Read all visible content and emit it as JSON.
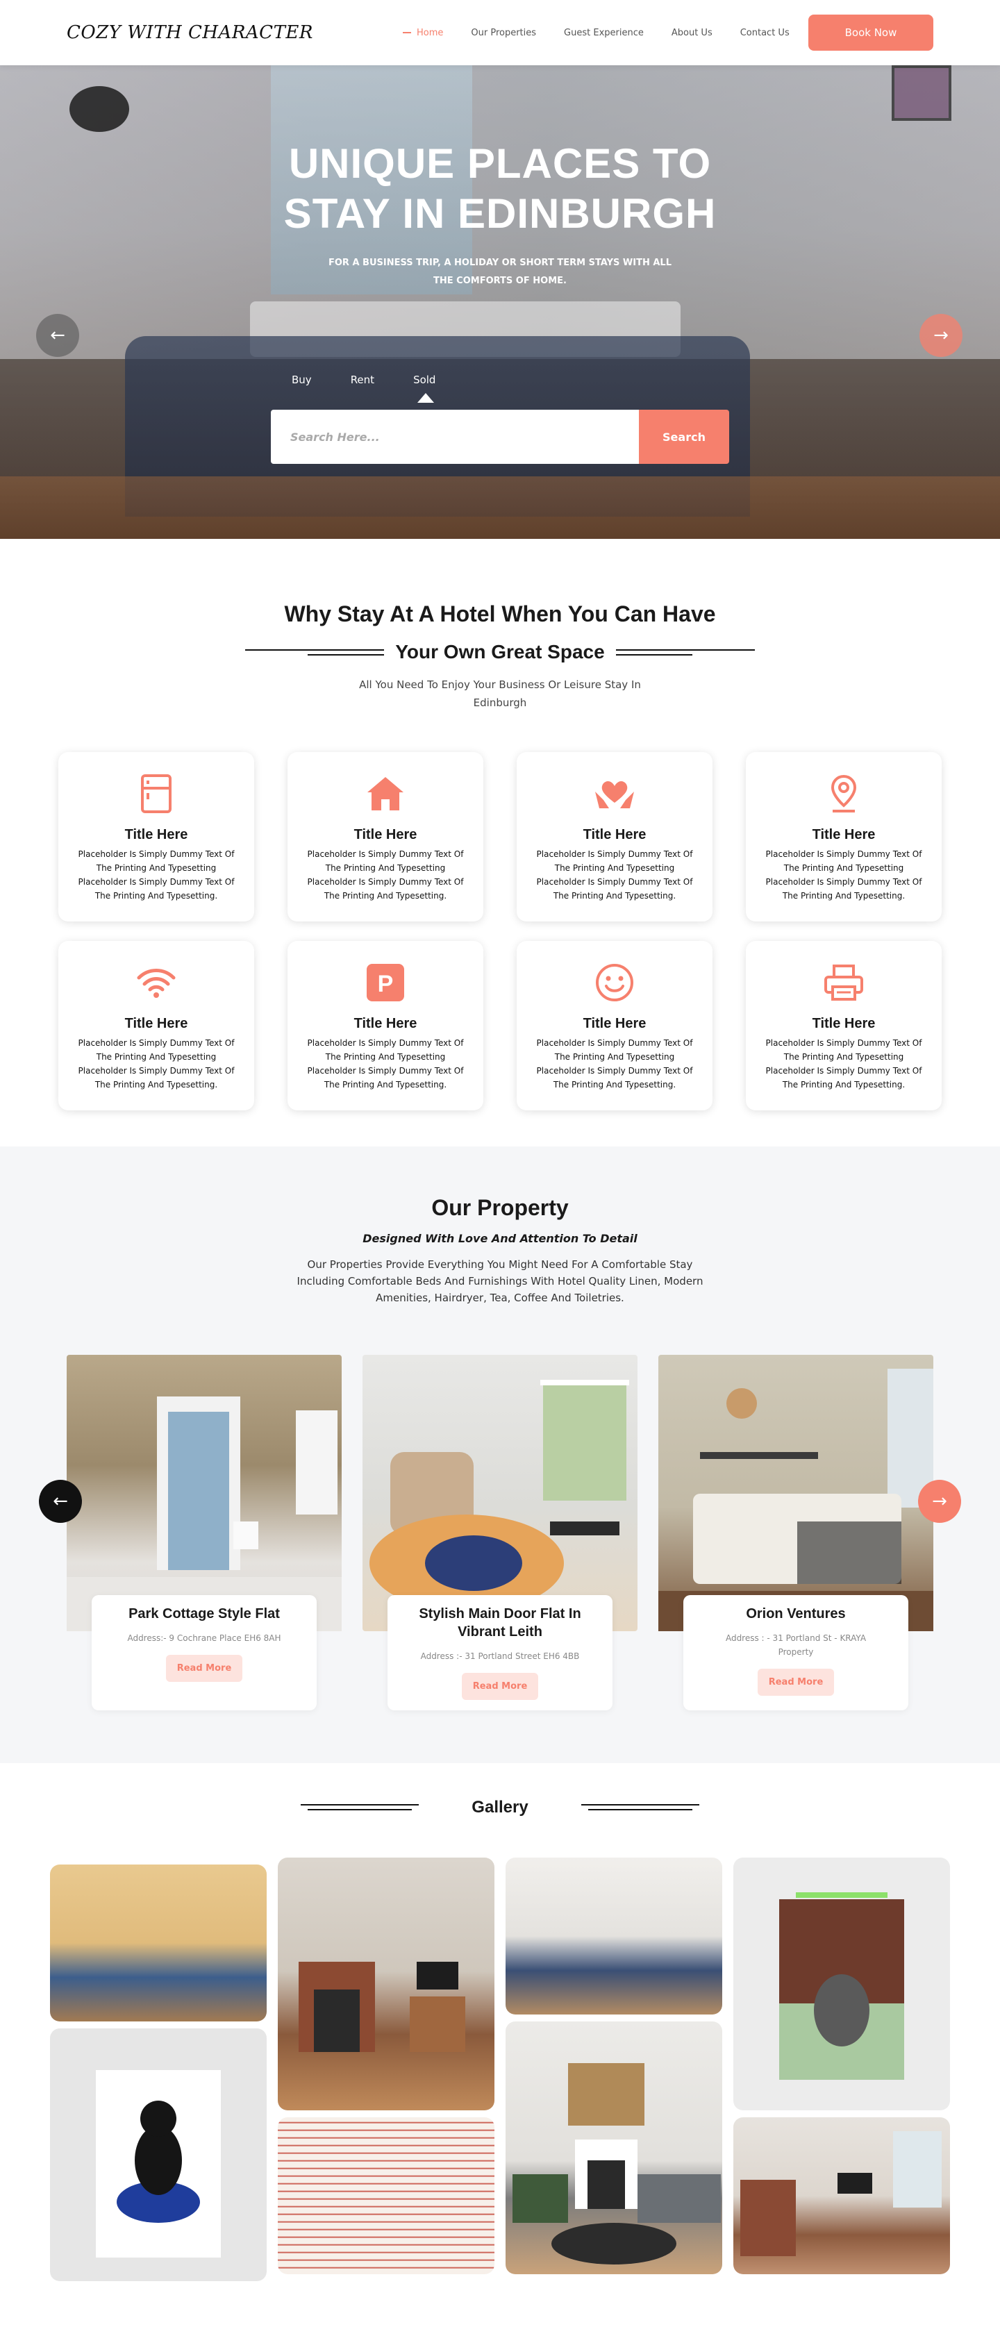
{
  "nav": {
    "logo": "COZY WITH CHARACTER",
    "items": [
      "Home",
      "Our Properties",
      "Guest Experience",
      "About Us",
      "Contact Us"
    ],
    "book_label": "Book Now"
  },
  "hero": {
    "title_line1": "UNIQUE PLACES TO",
    "title_line2": "STAY IN EDINBURGH",
    "subtitle": "FOR A BUSINESS TRIP, A HOLIDAY OR SHORT TERM STAYS WITH ALL THE COMFORTS OF HOME.",
    "tabs": [
      "Buy",
      "Rent",
      "Sold"
    ],
    "search_placeholder": "Search Here...",
    "search_label": "Search",
    "prev_icon": "arrow-left-icon",
    "next_icon": "arrow-right-icon"
  },
  "why": {
    "title": "Why Stay At A Hotel When You Can Have",
    "subtitle": "Your Own Great Space",
    "desc": "All You Need To Enjoy Your Business Or Leisure Stay In Edinburgh",
    "features": [
      {
        "icon": "fridge-icon",
        "title": "Title Here",
        "text": "Placeholder Is Simply Dummy Text Of The Printing And Typesetting Placeholder Is Simply Dummy Text Of The Printing And Typesetting."
      },
      {
        "icon": "home-icon",
        "title": "Title Here",
        "text": "Placeholder Is Simply Dummy Text Of The Printing And Typesetting Placeholder Is Simply Dummy Text Of The Printing And Typesetting."
      },
      {
        "icon": "heart-hands-icon",
        "title": "Title Here",
        "text": "Placeholder Is Simply Dummy Text Of The Printing And Typesetting Placeholder Is Simply Dummy Text Of The Printing And Typesetting."
      },
      {
        "icon": "location-pin-icon",
        "title": "Title Here",
        "text": "Placeholder Is Simply Dummy Text Of The Printing And Typesetting Placeholder Is Simply Dummy Text Of The Printing And Typesetting."
      },
      {
        "icon": "wifi-icon",
        "title": "Title Here",
        "text": "Placeholder Is Simply Dummy Text Of The Printing And Typesetting Placeholder Is Simply Dummy Text Of The Printing And Typesetting."
      },
      {
        "icon": "parking-icon",
        "title": "Title Here",
        "text": "Placeholder Is Simply Dummy Text Of The Printing And Typesetting Placeholder Is Simply Dummy Text Of The Printing And Typesetting."
      },
      {
        "icon": "smiley-icon",
        "title": "Title Here",
        "text": "Placeholder Is Simply Dummy Text Of The Printing And Typesetting Placeholder Is Simply Dummy Text Of The Printing And Typesetting."
      },
      {
        "icon": "printer-icon",
        "title": "Title Here",
        "text": "Placeholder Is Simply Dummy Text Of The Printing And Typesetting Placeholder Is Simply Dummy Text Of The Printing And Typesetting."
      }
    ]
  },
  "property": {
    "title": "Our Property",
    "tagline": "Designed With Love And Attention To Detail",
    "desc": "Our Properties Provide Everything You Might Need For A Comfortable Stay Including Comfortable Beds And Furnishings With Hotel Quality Linen, Modern Amenities, Hairdryer, Tea, Coffee And Toiletries.",
    "cards": [
      {
        "name": "Park Cottage Style Flat",
        "address": "Address:- 9 Cochrane Place EH6 8AH",
        "more": "Read More"
      },
      {
        "name": "Stylish Main Door Flat In Vibrant Leith",
        "address": "Address :- 31 Portland Street EH6 4BB",
        "more": "Read More"
      },
      {
        "name": "Orion Ventures",
        "address": "Address : - 31 Portland St - KRAYA Property",
        "more": "Read More"
      }
    ]
  },
  "gallery": {
    "title": "Gallery"
  },
  "colors": {
    "accent": "#f6806d",
    "accent_soft": "#fde3de",
    "dark": "#111111",
    "section_bg": "#f5f6f8"
  }
}
